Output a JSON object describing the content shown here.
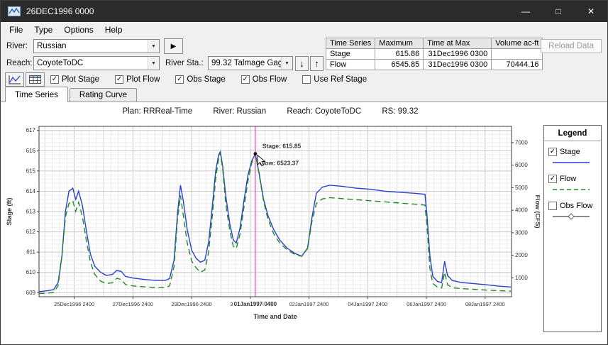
{
  "window": {
    "title": "26DEC1996 0000"
  },
  "icons": {
    "dropdown": "▼",
    "play": "▶",
    "down": "↓",
    "up": "↑",
    "minimize": "—",
    "maximize": "□",
    "close": "✕",
    "check": "✓"
  },
  "menu": {
    "items": [
      "File",
      "Type",
      "Options",
      "Help"
    ]
  },
  "controls": {
    "river_label": "River:",
    "river_value": "Russian",
    "reach_label": "Reach:",
    "reach_value": "CoyoteToDC",
    "river_sta_label": "River Sta.:",
    "river_sta_value": "99.32 Talmage Gage",
    "reload_button": "Reload Data",
    "checkboxes": [
      {
        "label": "Plot Stage",
        "checked": true
      },
      {
        "label": "Plot Flow",
        "checked": true
      },
      {
        "label": "Obs Stage",
        "checked": true
      },
      {
        "label": "Obs Flow",
        "checked": true
      },
      {
        "label": "Use Ref Stage",
        "checked": false
      }
    ]
  },
  "summary_table": {
    "headers": [
      "Time Series",
      "Maximum",
      "Time at Max",
      "Volume ac-ft"
    ],
    "rows": [
      [
        "Stage",
        "615.86",
        "31Dec1996 0300",
        ""
      ],
      [
        "Flow",
        "6545.85",
        "31Dec1996 0300",
        "70444.16"
      ]
    ]
  },
  "tabs": [
    {
      "label": "Time Series",
      "active": true
    },
    {
      "label": "Rating Curve",
      "active": false
    }
  ],
  "plot_header": {
    "plan": "Plan: RRReal-Time",
    "river": "River: Russian",
    "reach": "Reach: CoyoteToDC",
    "rs": "RS: 99.32"
  },
  "legend": {
    "title": "Legend",
    "items": [
      {
        "label": "Stage",
        "checked": true,
        "style": "solid-blue"
      },
      {
        "label": "Flow",
        "checked": true,
        "style": "dashed-green"
      },
      {
        "label": "Obs Flow",
        "checked": false,
        "style": "symbol"
      }
    ]
  },
  "chart_data": {
    "type": "line",
    "title": "Plan: RRReal-Time  River: Russian  Reach: CoyoteToDC  RS: 99.32",
    "xlabel": "Time and Date",
    "ylabel_left": "Stage (ft)",
    "ylabel_right": "Flow (CFS)",
    "x_unit": "days since 24Dec1996 0000",
    "x_domain": [
      0.8,
      16.9
    ],
    "stage_domain": [
      608.8,
      617.2
    ],
    "stage_ticks": [
      609,
      610,
      611,
      612,
      613,
      614,
      615,
      616,
      617
    ],
    "flow_ticks": [
      1000,
      2000,
      3000,
      4000,
      5000,
      6000,
      7000
    ],
    "flow_to_stage": {
      "offset": 608.62,
      "per_unit": 900
    },
    "grid": true,
    "legend_position": "right",
    "x_ticks": [
      {
        "t": 2,
        "label": "25Dec1996 2400"
      },
      {
        "t": 4,
        "label": "27Dec1996 2400"
      },
      {
        "t": 6,
        "label": "29Dec1996 2400"
      },
      {
        "t": 8,
        "label": "31Dec1996 2400"
      },
      {
        "t": 10,
        "label": "02Jan1997 2400"
      },
      {
        "t": 12,
        "label": "04Jan1997 2400"
      },
      {
        "t": 14,
        "label": "06Jan1997 2400"
      },
      {
        "t": 16,
        "label": "08Jan1997 2400"
      }
    ],
    "series": [
      {
        "name": "Stage",
        "axis": "stage",
        "color": "#2b3fd0",
        "dash": "none",
        "points": [
          [
            0.8,
            609.05
          ],
          [
            1.1,
            609.1
          ],
          [
            1.3,
            609.15
          ],
          [
            1.45,
            609.5
          ],
          [
            1.58,
            610.8
          ],
          [
            1.7,
            613.0
          ],
          [
            1.82,
            614.0
          ],
          [
            1.95,
            614.15
          ],
          [
            2.05,
            613.6
          ],
          [
            2.15,
            614.0
          ],
          [
            2.28,
            613.3
          ],
          [
            2.42,
            612.0
          ],
          [
            2.55,
            610.9
          ],
          [
            2.7,
            610.3
          ],
          [
            2.9,
            610.0
          ],
          [
            3.1,
            609.85
          ],
          [
            3.3,
            609.9
          ],
          [
            3.45,
            610.1
          ],
          [
            3.6,
            610.05
          ],
          [
            3.75,
            609.8
          ],
          [
            4.0,
            609.72
          ],
          [
            4.4,
            609.65
          ],
          [
            4.8,
            609.6
          ],
          [
            5.1,
            609.6
          ],
          [
            5.25,
            609.7
          ],
          [
            5.4,
            610.6
          ],
          [
            5.52,
            612.9
          ],
          [
            5.62,
            614.3
          ],
          [
            5.72,
            613.5
          ],
          [
            5.85,
            612.1
          ],
          [
            6.0,
            611.1
          ],
          [
            6.15,
            610.7
          ],
          [
            6.3,
            610.5
          ],
          [
            6.45,
            610.6
          ],
          [
            6.58,
            611.5
          ],
          [
            6.7,
            613.2
          ],
          [
            6.82,
            615.0
          ],
          [
            6.92,
            615.8
          ],
          [
            6.98,
            615.95
          ],
          [
            7.06,
            615.2
          ],
          [
            7.16,
            613.8
          ],
          [
            7.3,
            612.4
          ],
          [
            7.42,
            611.6
          ],
          [
            7.52,
            611.45
          ],
          [
            7.65,
            612.2
          ],
          [
            7.78,
            613.5
          ],
          [
            7.92,
            614.8
          ],
          [
            8.05,
            615.5
          ],
          [
            8.17,
            615.85
          ],
          [
            8.3,
            614.9
          ],
          [
            8.45,
            613.6
          ],
          [
            8.6,
            612.8
          ],
          [
            8.8,
            612.1
          ],
          [
            9.0,
            611.6
          ],
          [
            9.25,
            611.2
          ],
          [
            9.5,
            610.95
          ],
          [
            9.75,
            610.8
          ],
          [
            9.95,
            611.2
          ],
          [
            10.1,
            612.7
          ],
          [
            10.25,
            613.9
          ],
          [
            10.45,
            614.2
          ],
          [
            10.7,
            614.3
          ],
          [
            11.1,
            614.25
          ],
          [
            11.6,
            614.15
          ],
          [
            12.1,
            614.1
          ],
          [
            12.6,
            614.0
          ],
          [
            13.1,
            613.95
          ],
          [
            13.6,
            613.9
          ],
          [
            13.95,
            613.85
          ],
          [
            14.02,
            612.8
          ],
          [
            14.12,
            610.8
          ],
          [
            14.22,
            609.8
          ],
          [
            14.38,
            609.55
          ],
          [
            14.52,
            609.5
          ],
          [
            14.62,
            610.55
          ],
          [
            14.72,
            609.85
          ],
          [
            14.88,
            609.6
          ],
          [
            15.2,
            609.5
          ],
          [
            15.6,
            609.45
          ],
          [
            16.0,
            609.4
          ],
          [
            16.45,
            609.32
          ],
          [
            16.88,
            609.28
          ]
        ]
      },
      {
        "name": "Flow",
        "axis": "flow",
        "color": "#1f8b1f",
        "dash": "8 5",
        "points": [
          [
            0.8,
            300
          ],
          [
            1.1,
            320
          ],
          [
            1.3,
            360
          ],
          [
            1.45,
            650
          ],
          [
            1.58,
            2000
          ],
          [
            1.7,
            3700
          ],
          [
            1.82,
            4300
          ],
          [
            1.95,
            4420
          ],
          [
            2.05,
            3950
          ],
          [
            2.15,
            4350
          ],
          [
            2.28,
            3700
          ],
          [
            2.42,
            2600
          ],
          [
            2.55,
            1700
          ],
          [
            2.7,
            1150
          ],
          [
            2.9,
            850
          ],
          [
            3.1,
            750
          ],
          [
            3.3,
            780
          ],
          [
            3.45,
            980
          ],
          [
            3.6,
            930
          ],
          [
            3.75,
            700
          ],
          [
            4.0,
            640
          ],
          [
            4.4,
            600
          ],
          [
            4.8,
            570
          ],
          [
            5.1,
            560
          ],
          [
            5.25,
            640
          ],
          [
            5.4,
            1500
          ],
          [
            5.52,
            3600
          ],
          [
            5.62,
            4650
          ],
          [
            5.72,
            3750
          ],
          [
            5.85,
            2550
          ],
          [
            6.0,
            1750
          ],
          [
            6.15,
            1450
          ],
          [
            6.3,
            1250
          ],
          [
            6.45,
            1350
          ],
          [
            6.58,
            2150
          ],
          [
            6.7,
            3700
          ],
          [
            6.82,
            5400
          ],
          [
            6.92,
            6300
          ],
          [
            6.98,
            6545.85
          ],
          [
            7.06,
            5800
          ],
          [
            7.16,
            4300
          ],
          [
            7.3,
            3100
          ],
          [
            7.42,
            2400
          ],
          [
            7.52,
            2300
          ],
          [
            7.65,
            2950
          ],
          [
            7.78,
            4100
          ],
          [
            7.92,
            5300
          ],
          [
            8.05,
            6100
          ],
          [
            8.17,
            6523.37
          ],
          [
            8.3,
            5600
          ],
          [
            8.45,
            4400
          ],
          [
            8.6,
            3600
          ],
          [
            8.8,
            2950
          ],
          [
            9.0,
            2550
          ],
          [
            9.25,
            2250
          ],
          [
            9.5,
            2050
          ],
          [
            9.75,
            1950
          ],
          [
            9.95,
            2300
          ],
          [
            10.1,
            3500
          ],
          [
            10.25,
            4300
          ],
          [
            10.45,
            4500
          ],
          [
            10.7,
            4560
          ],
          [
            11.1,
            4520
          ],
          [
            11.6,
            4470
          ],
          [
            12.1,
            4420
          ],
          [
            12.6,
            4370
          ],
          [
            13.1,
            4320
          ],
          [
            13.6,
            4270
          ],
          [
            13.95,
            4230
          ],
          [
            14.02,
            3300
          ],
          [
            14.12,
            1400
          ],
          [
            14.22,
            750
          ],
          [
            14.38,
            580
          ],
          [
            14.52,
            550
          ],
          [
            14.62,
            1250
          ],
          [
            14.72,
            700
          ],
          [
            14.88,
            560
          ],
          [
            15.2,
            520
          ],
          [
            15.6,
            490
          ],
          [
            16.0,
            460
          ],
          [
            16.45,
            430
          ],
          [
            16.88,
            410
          ]
        ]
      }
    ],
    "crosshair": {
      "t": 8.17,
      "label": "01Jan1997 0400",
      "stage_value": 615.85,
      "flow_value": 6523.37,
      "stage_annotation": "Stage: 615.85",
      "flow_annotation": "Flow: 6523.37",
      "color": "#e544b8"
    }
  }
}
